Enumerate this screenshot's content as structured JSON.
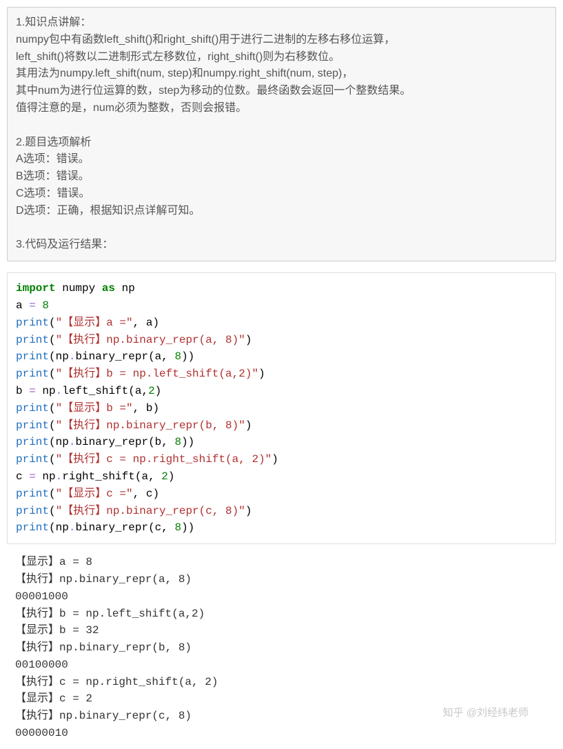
{
  "explanation": {
    "lines": [
      "1.知识点讲解：",
      "numpy包中有函数left_shift()和right_shift()用于进行二进制的左移右移位运算，",
      "left_shift()将数以二进制形式左移数位，right_shift()则为右移数位。",
      "其用法为numpy.left_shift(num, step)和numpy.right_shift(num, step)，",
      "其中num为进行位运算的数，step为移动的位数。最终函数会返回一个整数结果。",
      "值得注意的是，num必须为整数，否则会报错。",
      "",
      "2.题目选项解析",
      "A选项：错误。",
      "B选项：错误。",
      "C选项：错误。",
      "D选项：正确，根据知识点详解可知。",
      "",
      "3.代码及运行结果："
    ]
  },
  "code": {
    "tokens": [
      [
        {
          "t": "import",
          "c": "kw"
        },
        {
          "t": " numpy ",
          "c": "nm"
        },
        {
          "t": "as",
          "c": "kw"
        },
        {
          "t": " np",
          "c": "nm"
        }
      ],
      [
        {
          "t": "a ",
          "c": "nm"
        },
        {
          "t": "=",
          "c": "op"
        },
        {
          "t": " ",
          "c": "nm"
        },
        {
          "t": "8",
          "c": "num"
        }
      ],
      [
        {
          "t": "print",
          "c": "fn"
        },
        {
          "t": "(",
          "c": "nm"
        },
        {
          "t": "\"【显示】a =\"",
          "c": "str"
        },
        {
          "t": ", a)",
          "c": "nm"
        }
      ],
      [
        {
          "t": "print",
          "c": "fn"
        },
        {
          "t": "(",
          "c": "nm"
        },
        {
          "t": "\"【执行】np.binary_repr(a, 8)\"",
          "c": "str"
        },
        {
          "t": ")",
          "c": "nm"
        }
      ],
      [
        {
          "t": "print",
          "c": "fn"
        },
        {
          "t": "(np",
          "c": "nm"
        },
        {
          "t": ".",
          "c": "op"
        },
        {
          "t": "binary_repr",
          "c": "nm"
        },
        {
          "t": "(a, ",
          "c": "nm"
        },
        {
          "t": "8",
          "c": "num"
        },
        {
          "t": "))",
          "c": "nm"
        }
      ],
      [
        {
          "t": "print",
          "c": "fn"
        },
        {
          "t": "(",
          "c": "nm"
        },
        {
          "t": "\"【执行】b = np.left_shift(a,2)\"",
          "c": "str"
        },
        {
          "t": ")",
          "c": "nm"
        }
      ],
      [
        {
          "t": "b ",
          "c": "nm"
        },
        {
          "t": "=",
          "c": "op"
        },
        {
          "t": " np",
          "c": "nm"
        },
        {
          "t": ".",
          "c": "op"
        },
        {
          "t": "left_shift",
          "c": "nm"
        },
        {
          "t": "(a,",
          "c": "nm"
        },
        {
          "t": "2",
          "c": "num"
        },
        {
          "t": ")",
          "c": "nm"
        }
      ],
      [
        {
          "t": "print",
          "c": "fn"
        },
        {
          "t": "(",
          "c": "nm"
        },
        {
          "t": "\"【显示】b =\"",
          "c": "str"
        },
        {
          "t": ", b)",
          "c": "nm"
        }
      ],
      [
        {
          "t": "print",
          "c": "fn"
        },
        {
          "t": "(",
          "c": "nm"
        },
        {
          "t": "\"【执行】np.binary_repr(b, 8)\"",
          "c": "str"
        },
        {
          "t": ")",
          "c": "nm"
        }
      ],
      [
        {
          "t": "print",
          "c": "fn"
        },
        {
          "t": "(np",
          "c": "nm"
        },
        {
          "t": ".",
          "c": "op"
        },
        {
          "t": "binary_repr",
          "c": "nm"
        },
        {
          "t": "(b, ",
          "c": "nm"
        },
        {
          "t": "8",
          "c": "num"
        },
        {
          "t": "))",
          "c": "nm"
        }
      ],
      [
        {
          "t": "print",
          "c": "fn"
        },
        {
          "t": "(",
          "c": "nm"
        },
        {
          "t": "\"【执行】c = np.right_shift(a, 2)\"",
          "c": "str"
        },
        {
          "t": ")",
          "c": "nm"
        }
      ],
      [
        {
          "t": "c ",
          "c": "nm"
        },
        {
          "t": "=",
          "c": "op"
        },
        {
          "t": " np",
          "c": "nm"
        },
        {
          "t": ".",
          "c": "op"
        },
        {
          "t": "right_shift",
          "c": "nm"
        },
        {
          "t": "(a, ",
          "c": "nm"
        },
        {
          "t": "2",
          "c": "num"
        },
        {
          "t": ")",
          "c": "nm"
        }
      ],
      [
        {
          "t": "print",
          "c": "fn"
        },
        {
          "t": "(",
          "c": "nm"
        },
        {
          "t": "\"【显示】c =\"",
          "c": "str"
        },
        {
          "t": ", c)",
          "c": "nm"
        }
      ],
      [
        {
          "t": "print",
          "c": "fn"
        },
        {
          "t": "(",
          "c": "nm"
        },
        {
          "t": "\"【执行】np.binary_repr(c, 8)\"",
          "c": "str"
        },
        {
          "t": ")",
          "c": "nm"
        }
      ],
      [
        {
          "t": "print",
          "c": "fn"
        },
        {
          "t": "(np",
          "c": "nm"
        },
        {
          "t": ".",
          "c": "op"
        },
        {
          "t": "binary_repr",
          "c": "nm"
        },
        {
          "t": "(c, ",
          "c": "nm"
        },
        {
          "t": "8",
          "c": "num"
        },
        {
          "t": "))",
          "c": "nm"
        }
      ]
    ]
  },
  "output": {
    "lines": [
      "【显示】a = 8",
      "【执行】np.binary_repr(a, 8)",
      "00001000",
      "【执行】b = np.left_shift(a,2)",
      "【显示】b = 32",
      "【执行】np.binary_repr(b, 8)",
      "00100000",
      "【执行】c = np.right_shift(a, 2)",
      "【显示】c = 2",
      "【执行】np.binary_repr(c, 8)",
      "00000010"
    ]
  },
  "watermark": "知乎 @刘经纬老师"
}
